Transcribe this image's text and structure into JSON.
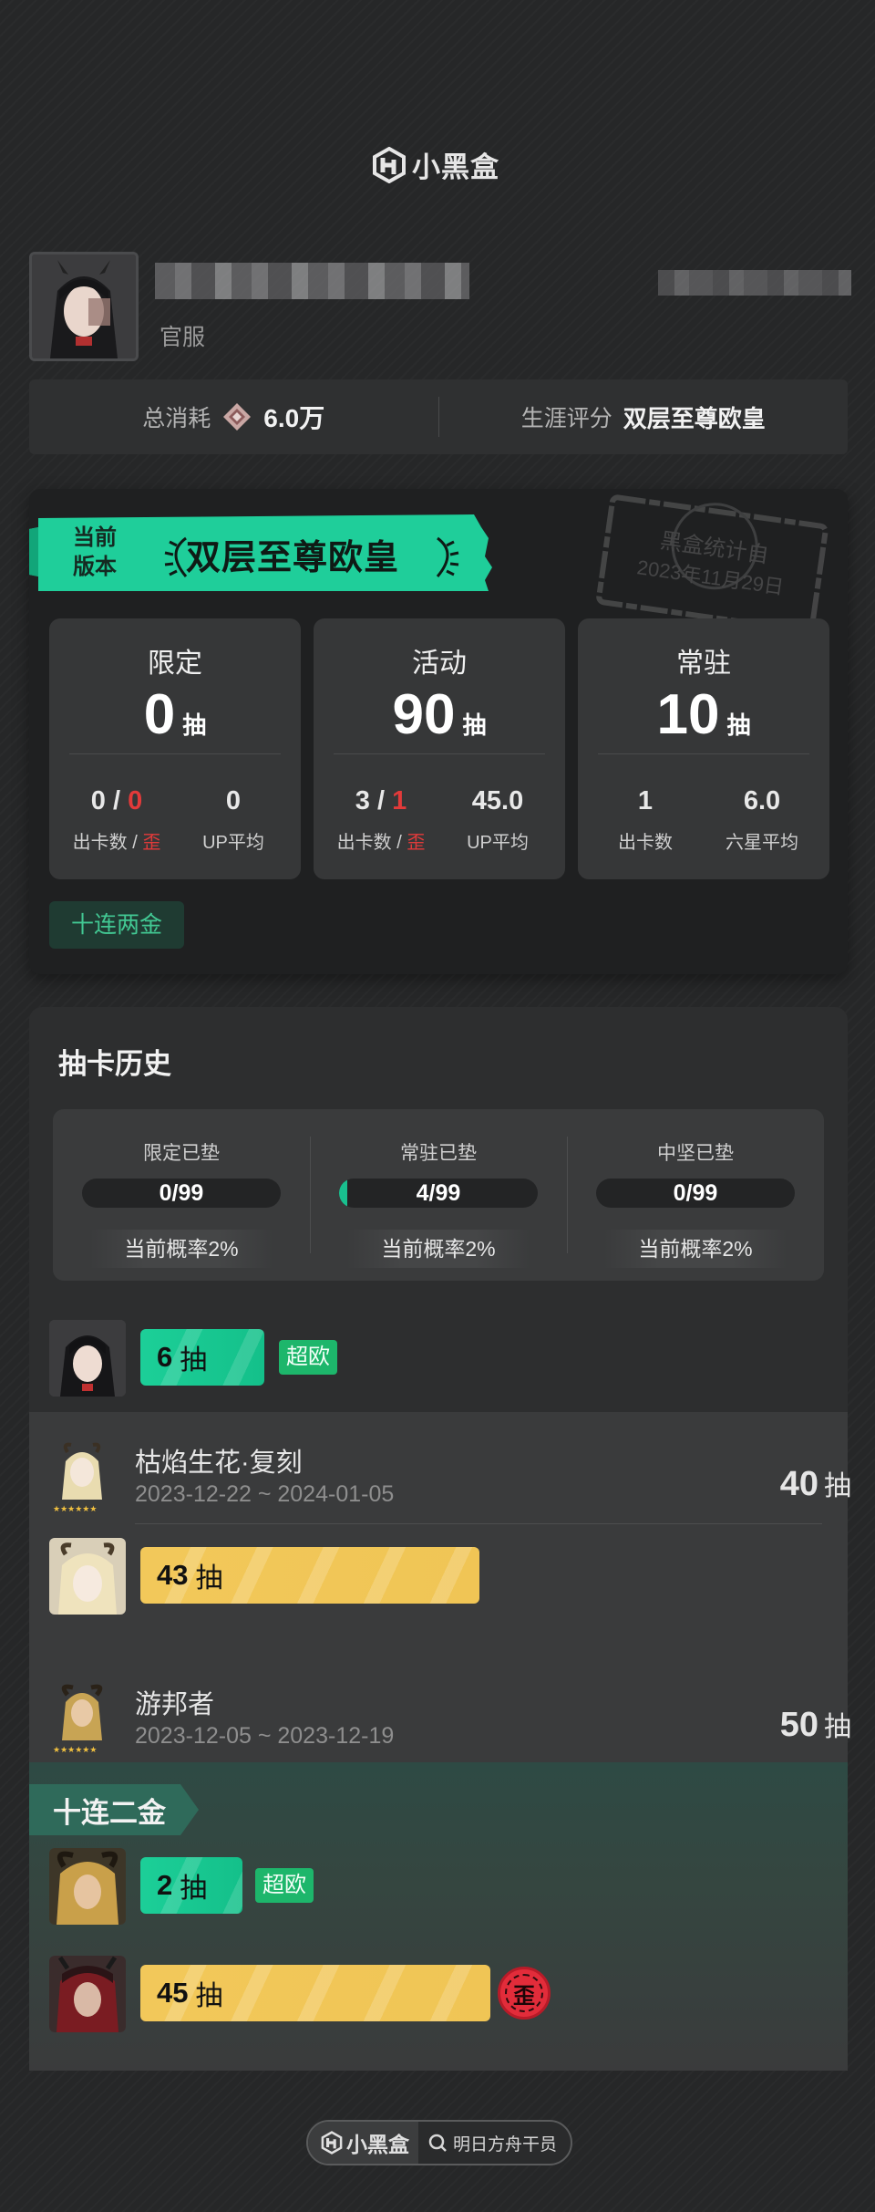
{
  "header": {
    "logo_text": "小黑盒"
  },
  "profile": {
    "server": "官服"
  },
  "summary": {
    "spend_label": "总消耗",
    "spend_value": "6.0万",
    "rating_label": "生涯评分",
    "rating_value": "双层至尊欧皇"
  },
  "card": {
    "banner_small_1": "当前",
    "banner_small_2": "版本",
    "banner_title": "双层至尊欧皇",
    "stamp_line1": "黑盒统计自",
    "stamp_line2": "2023年11月29日",
    "stats": [
      {
        "title": "限定",
        "pulls": "0",
        "unit": "抽",
        "left_a": "0 /",
        "left_b": "0",
        "left_lbl_a": "出卡数 /",
        "left_lbl_b": "歪",
        "right_val": "0",
        "right_lbl": "UP平均"
      },
      {
        "title": "活动",
        "pulls": "90",
        "unit": "抽",
        "left_a": "3 /",
        "left_b": "1",
        "left_lbl_a": "出卡数 /",
        "left_lbl_b": "歪",
        "right_val": "45.0",
        "right_lbl": "UP平均"
      },
      {
        "title": "常驻",
        "pulls": "10",
        "unit": "抽",
        "left_a": "1",
        "left_lbl_a": "出卡数",
        "right_val": "6.0",
        "right_lbl": "六星平均"
      }
    ],
    "tag": "十连两金"
  },
  "history": {
    "title": "抽卡历史",
    "pity": [
      {
        "label": "限定已垫",
        "value": "0/99",
        "fill": 0,
        "rate": "当前概率2%"
      },
      {
        "label": "常驻已垫",
        "value": "4/99",
        "fill": 0.04,
        "rate": "当前概率2%"
      },
      {
        "label": "中坚已垫",
        "value": "0/99",
        "fill": 0,
        "rate": "当前概率2%"
      }
    ],
    "first_pull": {
      "count": "6",
      "unit": "抽",
      "badge": "超欧"
    },
    "banners": [
      {
        "name": "枯焰生花·复刻",
        "date": "2023-12-22 ~ 2024-01-05",
        "total": "40",
        "unit": "抽",
        "pulls": [
          {
            "count": "43",
            "unit": "抽"
          }
        ]
      },
      {
        "name": "游邦者",
        "date": "2023-12-05 ~ 2023-12-19",
        "total": "50",
        "unit": "抽",
        "tag": "十连二金",
        "pulls": [
          {
            "count": "2",
            "unit": "抽",
            "badge": "超欧"
          },
          {
            "count": "45",
            "unit": "抽",
            "off": "歪"
          }
        ]
      }
    ]
  },
  "footer": {
    "logo_text": "小黑盒",
    "search_text": "明日方舟干员"
  },
  "colors": {
    "accent_green": "#19c08f",
    "pill_yellow": "#f0c555",
    "red": "#e23a3a",
    "badge_green": "#1db66b"
  }
}
